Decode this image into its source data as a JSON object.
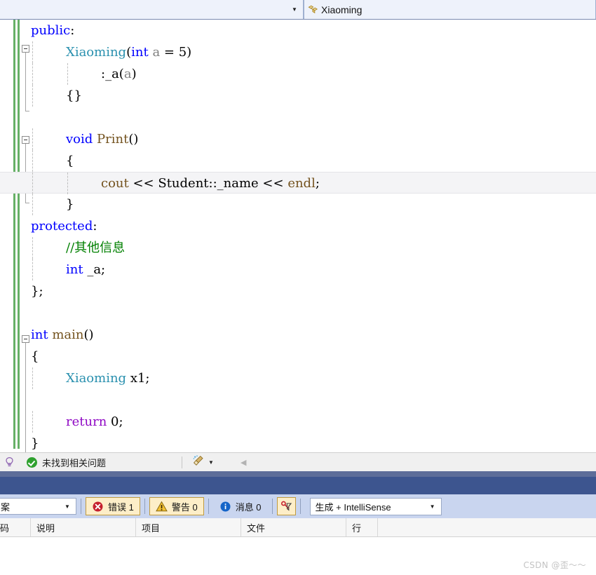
{
  "nav_bar": {
    "scope_combo": {
      "value": "",
      "arrow": "▼",
      "name": "scope-dropdown"
    },
    "member_combo": {
      "value": "Xiaoming",
      "icon": "method-icon",
      "name": "member-dropdown"
    }
  },
  "editor": {
    "font_size": 18,
    "line_height": 31,
    "current_line_index": 7,
    "lines": [
      {
        "indent": 0,
        "tokens": [
          {
            "t": "public",
            "c": "t-key"
          },
          {
            "t": ":",
            "c": "t-plain"
          }
        ]
      },
      {
        "indent": 1,
        "tokens": [
          {
            "t": "Xiaoming",
            "c": "t-type"
          },
          {
            "t": "(",
            "c": "t-plain"
          },
          {
            "t": "int",
            "c": "t-key"
          },
          {
            "t": " ",
            "c": "t-plain"
          },
          {
            "t": "a",
            "c": "t-param"
          },
          {
            "t": " = ",
            "c": "t-plain"
          },
          {
            "t": "5",
            "c": "t-num"
          },
          {
            "t": ")",
            "c": "t-plain"
          }
        ]
      },
      {
        "indent": 2,
        "tokens": [
          {
            "t": ":_a(",
            "c": "t-plain"
          },
          {
            "t": "a",
            "c": "t-param"
          },
          {
            "t": ")",
            "c": "t-plain"
          }
        ]
      },
      {
        "indent": 1,
        "tokens": [
          {
            "t": "{}",
            "c": "t-brace"
          }
        ]
      },
      {
        "indent": 0,
        "tokens": []
      },
      {
        "indent": 1,
        "tokens": [
          {
            "t": "void",
            "c": "t-key"
          },
          {
            "t": " ",
            "c": "t-plain"
          },
          {
            "t": "Print",
            "c": "t-fn"
          },
          {
            "t": "()",
            "c": "t-plain"
          }
        ]
      },
      {
        "indent": 1,
        "tokens": [
          {
            "t": "{",
            "c": "t-brace"
          }
        ]
      },
      {
        "indent": 2,
        "tokens": [
          {
            "t": "cout",
            "c": "t-lib"
          },
          {
            "t": " << ",
            "c": "t-plain"
          },
          {
            "t": "Student::_name",
            "c": "t-plain"
          },
          {
            "t": " << ",
            "c": "t-plain"
          },
          {
            "t": "endl",
            "c": "t-lib"
          },
          {
            "t": ";",
            "c": "t-plain"
          }
        ]
      },
      {
        "indent": 1,
        "tokens": [
          {
            "t": "}",
            "c": "t-brace"
          }
        ]
      },
      {
        "indent": 0,
        "tokens": [
          {
            "t": "protected",
            "c": "t-key"
          },
          {
            "t": ":",
            "c": "t-plain"
          }
        ]
      },
      {
        "indent": 1,
        "tokens": [
          {
            "t": "//其他信息",
            "c": "t-cmt"
          }
        ]
      },
      {
        "indent": 1,
        "tokens": [
          {
            "t": "int",
            "c": "t-key"
          },
          {
            "t": " _a;",
            "c": "t-plain"
          }
        ]
      },
      {
        "indent": 0,
        "tokens": [
          {
            "t": "};",
            "c": "t-brace"
          }
        ]
      },
      {
        "indent": 0,
        "tokens": []
      },
      {
        "indent": 0,
        "tokens": [
          {
            "t": "int",
            "c": "t-key"
          },
          {
            "t": " ",
            "c": "t-plain"
          },
          {
            "t": "main",
            "c": "t-fn"
          },
          {
            "t": "()",
            "c": "t-plain"
          }
        ]
      },
      {
        "indent": 0,
        "tokens": [
          {
            "t": "{",
            "c": "t-brace"
          }
        ]
      },
      {
        "indent": 1,
        "tokens": [
          {
            "t": "Xiaoming",
            "c": "t-type"
          },
          {
            "t": " x1;",
            "c": "t-plain"
          }
        ]
      },
      {
        "indent": 0,
        "tokens": []
      },
      {
        "indent": 1,
        "tokens": [
          {
            "t": "return",
            "c": "t-ctl"
          },
          {
            "t": " ",
            "c": "t-plain"
          },
          {
            "t": "0",
            "c": "t-num"
          },
          {
            "t": ";",
            "c": "t-plain"
          }
        ]
      },
      {
        "indent": 0,
        "tokens": [
          {
            "t": "}",
            "c": "t-brace"
          }
        ]
      }
    ],
    "change_bar_color": "#66b066"
  },
  "hint_strip": {
    "bulb_icon": "lightbulb-icon",
    "status_icon": "green-check-icon",
    "status_text": "未找到相关问题",
    "broom_icon": "code-cleanup-broom-icon",
    "broom_caret": "▼",
    "back_arrow": "◀"
  },
  "error_list": {
    "scope_combo": {
      "value": "案",
      "arrow": "▼"
    },
    "buttons": [
      {
        "name": "errors-filter",
        "icon": "error-x-icon",
        "label": "错误 1",
        "pressed": true
      },
      {
        "name": "warnings-filter",
        "icon": "warning-triangle-icon",
        "label": "警告 0",
        "pressed": true
      },
      {
        "name": "messages-filter",
        "icon": "info-circle-icon",
        "label": "消息 0",
        "pressed": false
      },
      {
        "name": "filter-toggle",
        "icon": "filter-key-icon",
        "label": "",
        "pressed": true
      }
    ],
    "source_select": {
      "value": "生成 + IntelliSense",
      "arrow": "▼"
    },
    "columns": [
      {
        "name": "code",
        "label": "码"
      },
      {
        "name": "description",
        "label": "说明"
      },
      {
        "name": "project",
        "label": "项目"
      },
      {
        "name": "file",
        "label": "文件"
      },
      {
        "name": "line",
        "label": "行"
      }
    ],
    "rows": []
  },
  "watermark": {
    "text": "CSDN @歪～～"
  },
  "colors": {
    "keyword": "#0000ff",
    "type": "#2b91af",
    "function": "#74531f",
    "comment": "#008000",
    "control": "#8f08c4",
    "param": "#808080",
    "accent_band": "#3d558f",
    "toolbar_bg": "#c9d5ef",
    "pressed_btn_bg": "#fdeec8",
    "pressed_btn_border": "#c09b3f"
  }
}
